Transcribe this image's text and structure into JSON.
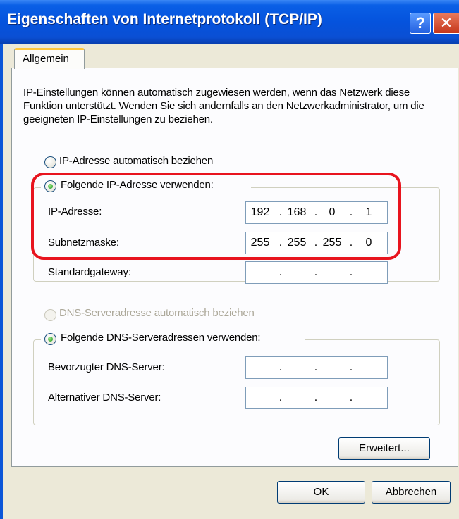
{
  "window": {
    "title": "Eigenschaften von Internetprotokoll (TCP/IP)",
    "help_label": "?",
    "close_label": "✕"
  },
  "tabs": [
    {
      "label": "Allgemein",
      "selected": true
    }
  ],
  "general": {
    "intro": "IP-Einstellungen können automatisch zugewiesen werden, wenn das Netzwerk diese Funktion unterstützt. Wenden Sie sich andernfalls an den Netzwerkadministrator, um die geeigneten IP-Einstellungen zu beziehen.",
    "ip_auto_label": "IP-Adresse automatisch beziehen",
    "ip_manual_label": "Folgende IP-Adresse verwenden:",
    "ip_mode": "manual",
    "ip_address": {
      "label": "IP-Adresse:",
      "octets": [
        "192",
        "168",
        "0",
        "1"
      ]
    },
    "subnet_mask": {
      "label": "Subnetzmaske:",
      "octets": [
        "255",
        "255",
        "255",
        "0"
      ]
    },
    "default_gateway": {
      "label": "Standardgateway:",
      "octets": [
        "",
        "",
        "",
        ""
      ]
    },
    "dns_auto_label": "DNS-Serveradresse automatisch beziehen",
    "dns_manual_label": "Folgende DNS-Serveradressen verwenden:",
    "dns_mode": "manual",
    "preferred_dns": {
      "label": "Bevorzugter DNS-Server:",
      "octets": [
        "",
        "",
        "",
        ""
      ]
    },
    "alternate_dns": {
      "label": "Alternativer DNS-Server:",
      "octets": [
        "",
        "",
        "",
        ""
      ]
    },
    "advanced_label": "Erweitert..."
  },
  "footer": {
    "ok_label": "OK",
    "cancel_label": "Abbrechen"
  },
  "colors": {
    "titlebar": "#0553dd",
    "dialog_bg": "#ece9d8",
    "highlight": "#e8141e"
  }
}
